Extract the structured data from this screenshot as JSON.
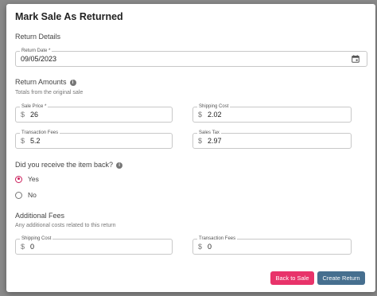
{
  "dialog": {
    "title": "Mark Sale As Returned"
  },
  "return_details": {
    "heading": "Return Details",
    "return_date": {
      "label": "Return Date *",
      "value": "09/05/2023"
    }
  },
  "return_amounts": {
    "heading": "Return Amounts",
    "subtext": "Totals from the original sale",
    "currency_symbol": "$",
    "sale_price": {
      "label": "Sale Price *",
      "value": "26"
    },
    "shipping_cost": {
      "label": "Shipping Cost",
      "value": "2.02"
    },
    "transaction_fees": {
      "label": "Transaction Fees",
      "value": "5.2"
    },
    "sales_tax": {
      "label": "Sales Tax",
      "value": "2.97"
    }
  },
  "item_back": {
    "question": "Did you receive the item back?",
    "options": [
      {
        "label": "Yes",
        "selected": true
      },
      {
        "label": "No",
        "selected": false
      }
    ]
  },
  "additional_fees": {
    "heading": "Additional Fees",
    "subtext": "Any additional costs related to this return",
    "shipping_cost": {
      "label": "Shipping Cost",
      "value": "0"
    },
    "transaction_fees": {
      "label": "Transaction Fees",
      "value": "0"
    }
  },
  "actions": {
    "back_label": "Back to Sale",
    "create_label": "Create Return"
  },
  "colors": {
    "accent_pink": "#e8336a",
    "radio_selected": "#cc1f5c",
    "primary_button": "#466f8f"
  }
}
